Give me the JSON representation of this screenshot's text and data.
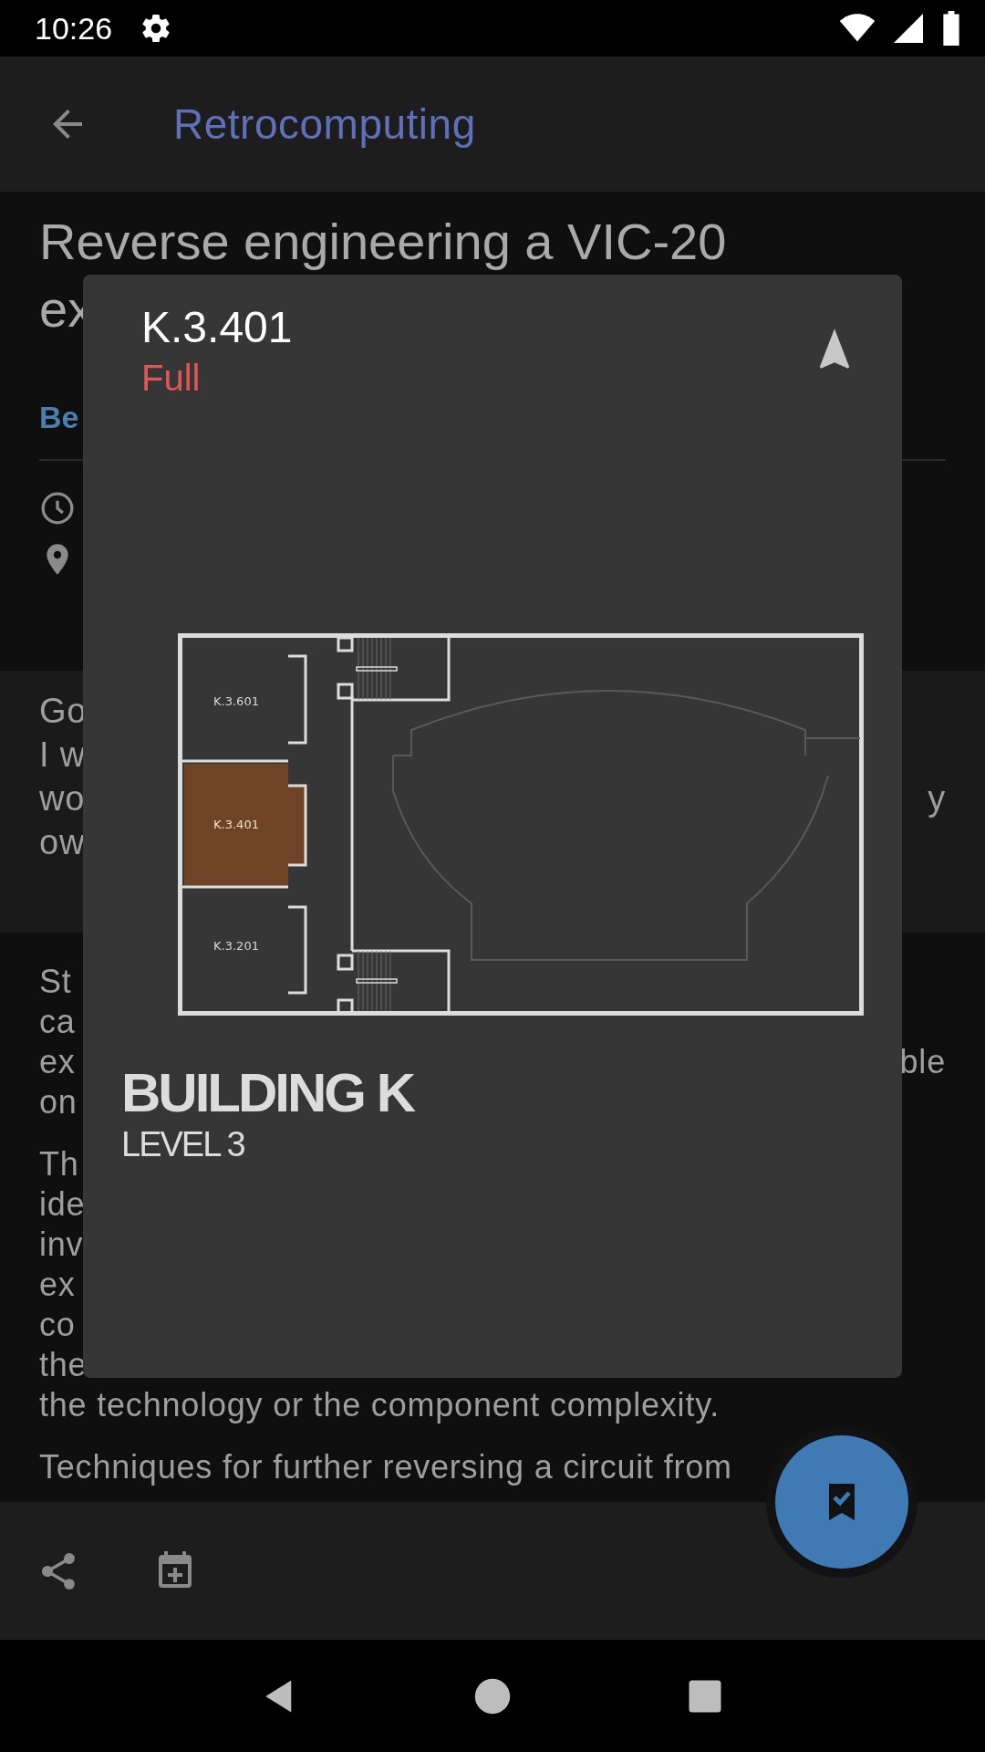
{
  "status_bar": {
    "time": "10:26"
  },
  "app_bar": {
    "title": "Retrocomputing"
  },
  "session": {
    "title_lines": [
      "Reverse engineering a VIC-20",
      "ex"
    ],
    "speaker": "Be"
  },
  "abstract": {
    "lines": [
      {
        "left": "Go"
      },
      {
        "left": "I w"
      },
      {
        "left": "wo",
        "right": "y"
      },
      {
        "left": "ow"
      }
    ]
  },
  "description": {
    "paragraphs": [
      [
        {
          "left": "St"
        },
        {
          "left": "ca"
        },
        {
          "left": "ex",
          "right": "ble"
        },
        {
          "left": "on"
        }
      ],
      [
        {
          "left": "Th"
        },
        {
          "left": "ide"
        },
        {
          "left": "inv"
        },
        {
          "left": "ex"
        },
        {
          "left": "co"
        },
        {
          "left": "the"
        },
        {
          "left": "the technology or the component complexity."
        }
      ],
      [
        {
          "left": "Techniques for further reversing a circuit from"
        }
      ]
    ]
  },
  "dialog": {
    "room": "K.3.401",
    "status": "Full",
    "map": {
      "rooms": [
        {
          "label": "K.3.601",
          "selected": false
        },
        {
          "label": "K.3.401",
          "selected": true
        },
        {
          "label": "K.3.201",
          "selected": false
        }
      ]
    },
    "building": "BUILDING K",
    "level": "LEVEL 3"
  },
  "fab": {
    "bookmarked": true
  }
}
